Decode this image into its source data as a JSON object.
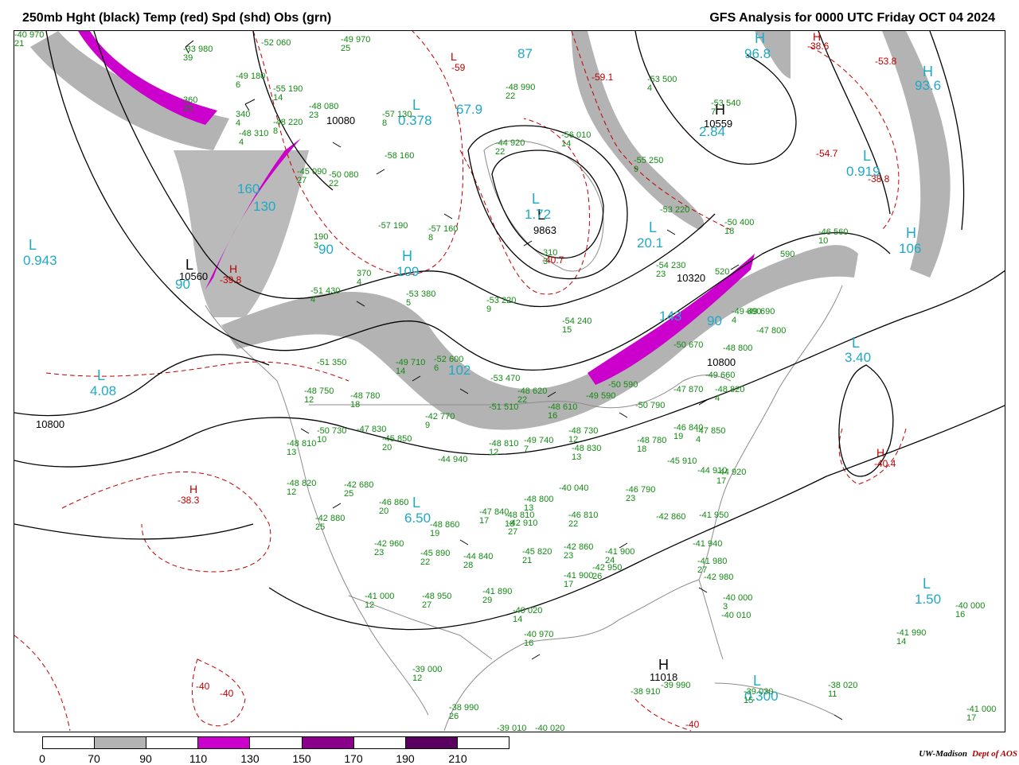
{
  "header": {
    "title_left": "250mb Hght (black) Temp (red) Spd (shd) Obs (grn)",
    "title_right": "GFS Analysis for 0000 UTC Friday  OCT 04 2024"
  },
  "colors": {
    "height_contour": "#000000",
    "temperature_contour": "#c00000",
    "observations": "#138a13",
    "speed_label": "#1ea9c8",
    "speed_70_90": "#b3b3b3",
    "speed_110_130": "#cc00cc",
    "speed_150_170": "#8b008b",
    "speed_190_210": "#5a0060",
    "borders": "#8c8c8c"
  },
  "height_labels": [
    {
      "text": "10080"
    },
    {
      "text": "10559"
    },
    {
      "text": "9863"
    },
    {
      "text": "10560"
    },
    {
      "text": "10320"
    },
    {
      "text": "10800"
    },
    {
      "text": "10800"
    },
    {
      "text": "11018"
    }
  ],
  "pressure_centers_black": [
    {
      "text": "H"
    },
    {
      "text": "L"
    },
    {
      "text": "L"
    },
    {
      "text": "H"
    }
  ],
  "temperature_labels": [
    {
      "text": "-38.6"
    },
    {
      "text": "-53.8"
    },
    {
      "text": "-59.1"
    },
    {
      "text": "-54.7"
    },
    {
      "text": "-38.8"
    },
    {
      "text": "-40.7"
    },
    {
      "text": "-39.8"
    },
    {
      "text": "-38.3"
    },
    {
      "text": "-40.4"
    },
    {
      "text": "-40"
    },
    {
      "text": "-40"
    },
    {
      "text": "-40"
    },
    {
      "text": "-59"
    }
  ],
  "temperature_centers": [
    {
      "text": "H"
    },
    {
      "text": "H"
    },
    {
      "text": "H"
    },
    {
      "text": "H"
    },
    {
      "text": "L"
    }
  ],
  "speed_labels": [
    {
      "text": "96.8"
    },
    {
      "text": "93.6"
    },
    {
      "text": "2.84"
    },
    {
      "text": "0.919"
    },
    {
      "text": "0.378"
    },
    {
      "text": "67.9"
    },
    {
      "text": "1.72"
    },
    {
      "text": "20.1"
    },
    {
      "text": "106"
    },
    {
      "text": "0.943"
    },
    {
      "text": "109"
    },
    {
      "text": "90"
    },
    {
      "text": "4.08"
    },
    {
      "text": "3.40"
    },
    {
      "text": "6.50"
    },
    {
      "text": "1.50"
    },
    {
      "text": "0.300"
    },
    {
      "text": "160"
    },
    {
      "text": "130"
    },
    {
      "text": "143"
    },
    {
      "text": "90"
    },
    {
      "text": "102"
    },
    {
      "text": "87"
    },
    {
      "text": "90"
    }
  ],
  "speed_centers": [
    {
      "text": "H"
    },
    {
      "text": "H"
    },
    {
      "text": "L"
    },
    {
      "text": "L"
    },
    {
      "text": "L"
    },
    {
      "text": "L"
    },
    {
      "text": "H"
    },
    {
      "text": "L"
    },
    {
      "text": "H"
    },
    {
      "text": "L"
    },
    {
      "text": "L"
    },
    {
      "text": "L"
    },
    {
      "text": "L"
    },
    {
      "text": "L"
    }
  ],
  "observations": [
    {
      "temp": "-33",
      "hgt": "980",
      "dew": "39"
    },
    {
      "temp": "-52",
      "hgt": "060",
      "dew": ""
    },
    {
      "temp": "-49",
      "hgt": "970",
      "dew": "25"
    },
    {
      "temp": "-49",
      "hgt": "180",
      "dew": "6"
    },
    {
      "temp": "-55",
      "hgt": "190",
      "dew": "14"
    },
    {
      "temp": "-48",
      "hgt": "080",
      "dew": "23"
    },
    {
      "temp": "-48",
      "hgt": "220",
      "dew": "8"
    },
    {
      "temp": "",
      "hgt": "360",
      "dew": "25"
    },
    {
      "temp": "",
      "hgt": "340",
      "dew": "4"
    },
    {
      "temp": "-48",
      "hgt": "310",
      "dew": "4"
    },
    {
      "temp": "-57",
      "hgt": "130",
      "dew": "8"
    },
    {
      "temp": "-58",
      "hgt": "160",
      "dew": ""
    },
    {
      "temp": "-45",
      "hgt": "090",
      "dew": "27"
    },
    {
      "temp": "-50",
      "hgt": "080",
      "dew": "22"
    },
    {
      "temp": "-48",
      "hgt": "990",
      "dew": "22"
    },
    {
      "temp": "-44",
      "hgt": "920",
      "dew": "22"
    },
    {
      "temp": "-56",
      "hgt": "010",
      "dew": "14"
    },
    {
      "temp": "-53",
      "hgt": "500",
      "dew": "4"
    },
    {
      "temp": "-53",
      "hgt": "540",
      "dew": "7"
    },
    {
      "temp": "-55",
      "hgt": "250",
      "dew": "9"
    },
    {
      "temp": "-53",
      "hgt": "220",
      "dew": ""
    },
    {
      "temp": "-50",
      "hgt": "400",
      "dew": "18"
    },
    {
      "temp": "-57",
      "hgt": "190",
      "dew": ""
    },
    {
      "temp": "-57",
      "hgt": "160",
      "dew": "8"
    },
    {
      "temp": "",
      "hgt": "190",
      "dew": "3"
    },
    {
      "temp": "-54",
      "hgt": "230",
      "dew": "23"
    },
    {
      "temp": "",
      "hgt": "310",
      "dew": "3"
    },
    {
      "temp": "",
      "hgt": "590",
      "dew": ""
    },
    {
      "temp": "-46",
      "hgt": "560",
      "dew": "10"
    },
    {
      "temp": "",
      "hgt": "520",
      "dew": ""
    },
    {
      "temp": "-51",
      "hgt": "430",
      "dew": "4"
    },
    {
      "temp": "",
      "hgt": "370",
      "dew": "4"
    },
    {
      "temp": "-53",
      "hgt": "380",
      "dew": "5"
    },
    {
      "temp": "-53",
      "hgt": "220",
      "dew": "9"
    },
    {
      "temp": "-54",
      "hgt": "240",
      "dew": "15"
    },
    {
      "temp": "-49",
      "hgt": "690",
      "dew": "4"
    },
    {
      "temp": "-49",
      "hgt": "690",
      "dew": ""
    },
    {
      "temp": "-47",
      "hgt": "800",
      "dew": ""
    },
    {
      "temp": "-50",
      "hgt": "670",
      "dew": ""
    },
    {
      "temp": "-48",
      "hgt": "800",
      "dew": ""
    },
    {
      "temp": "-51",
      "hgt": "350",
      "dew": ""
    },
    {
      "temp": "-49",
      "hgt": "710",
      "dew": "14"
    },
    {
      "temp": "-52",
      "hgt": "600",
      "dew": "6"
    },
    {
      "temp": "-53",
      "hgt": "470",
      "dew": ""
    },
    {
      "temp": "-48",
      "hgt": "620",
      "dew": "22"
    },
    {
      "temp": "-51",
      "hgt": "510",
      "dew": ""
    },
    {
      "temp": "-48",
      "hgt": "610",
      "dew": "16"
    },
    {
      "temp": "-49",
      "hgt": "590",
      "dew": ""
    },
    {
      "temp": "-50",
      "hgt": "590",
      "dew": ""
    },
    {
      "temp": "-49",
      "hgt": "660",
      "dew": ""
    },
    {
      "temp": "-48",
      "hgt": "820",
      "dew": "4"
    },
    {
      "temp": "-47",
      "hgt": "870",
      "dew": ""
    },
    {
      "temp": "-50",
      "hgt": "790",
      "dew": ""
    },
    {
      "temp": "-48",
      "hgt": "750",
      "dew": "12"
    },
    {
      "temp": "-48",
      "hgt": "780",
      "dew": "18"
    },
    {
      "temp": "-42",
      "hgt": "770",
      "dew": "9"
    },
    {
      "temp": "-50",
      "hgt": "730",
      "dew": "10"
    },
    {
      "temp": "-47",
      "hgt": "830",
      "dew": ""
    },
    {
      "temp": "-48",
      "hgt": "810",
      "dew": "13"
    },
    {
      "temp": "-45",
      "hgt": "850",
      "dew": "20"
    },
    {
      "temp": "-48",
      "hgt": "810",
      "dew": "12"
    },
    {
      "temp": "-49",
      "hgt": "740",
      "dew": "7"
    },
    {
      "temp": "-48",
      "hgt": "730",
      "dew": "12"
    },
    {
      "temp": "-48",
      "hgt": "830",
      "dew": "13"
    },
    {
      "temp": "-48",
      "hgt": "780",
      "dew": "18"
    },
    {
      "temp": "-46",
      "hgt": "840",
      "dew": "19"
    },
    {
      "temp": "-47",
      "hgt": "850",
      "dew": "4"
    },
    {
      "temp": "-45",
      "hgt": "910",
      "dew": ""
    },
    {
      "temp": "-44",
      "hgt": "910",
      "dew": ""
    },
    {
      "temp": "-44",
      "hgt": "920",
      "dew": "17"
    },
    {
      "temp": "-44",
      "hgt": "940",
      "dew": ""
    },
    {
      "temp": "-48",
      "hgt": "820",
      "dew": "12"
    },
    {
      "temp": "-42",
      "hgt": "680",
      "dew": "25"
    },
    {
      "temp": "-46",
      "hgt": "860",
      "dew": "20"
    },
    {
      "temp": "-48",
      "hgt": "860",
      "dew": "19"
    },
    {
      "temp": "-47",
      "hgt": "840",
      "dew": "17"
    },
    {
      "temp": "-48",
      "hgt": "800",
      "dew": "13"
    },
    {
      "temp": "-40",
      "hgt": "040",
      "dew": ""
    },
    {
      "temp": "-46",
      "hgt": "790",
      "dew": "23"
    },
    {
      "temp": "-42",
      "hgt": "880",
      "dew": "25"
    },
    {
      "temp": "-42",
      "hgt": "910",
      "dew": "27"
    },
    {
      "temp": "-48",
      "hgt": "810",
      "dew": "18"
    },
    {
      "temp": "-46",
      "hgt": "810",
      "dew": "22"
    },
    {
      "temp": "-42",
      "hgt": "860",
      "dew": ""
    },
    {
      "temp": "-41",
      "hgt": "950",
      "dew": ""
    },
    {
      "temp": "-42",
      "hgt": "960",
      "dew": "23"
    },
    {
      "temp": "-45",
      "hgt": "890",
      "dew": "22"
    },
    {
      "temp": "-44",
      "hgt": "840",
      "dew": "28"
    },
    {
      "temp": "-45",
      "hgt": "820",
      "dew": "21"
    },
    {
      "temp": "-42",
      "hgt": "860",
      "dew": "23"
    },
    {
      "temp": "-41",
      "hgt": "900",
      "dew": "24"
    },
    {
      "temp": "-41",
      "hgt": "940",
      "dew": ""
    },
    {
      "temp": "-41",
      "hgt": "980",
      "dew": "27"
    },
    {
      "temp": "-41",
      "hgt": "000",
      "dew": "12"
    },
    {
      "temp": "-48",
      "hgt": "950",
      "dew": "27"
    },
    {
      "temp": "-41",
      "hgt": "890",
      "dew": "29"
    },
    {
      "temp": "-41",
      "hgt": "900",
      "dew": "17"
    },
    {
      "temp": "-42",
      "hgt": "950",
      "dew": "26"
    },
    {
      "temp": "-42",
      "hgt": "980",
      "dew": ""
    },
    {
      "temp": "-40",
      "hgt": "000",
      "dew": "3"
    },
    {
      "temp": "-40",
      "hgt": "010",
      "dew": ""
    },
    {
      "temp": "-40",
      "hgt": "020",
      "dew": "14"
    },
    {
      "temp": "-40",
      "hgt": "970",
      "dew": "16"
    },
    {
      "temp": "-39",
      "hgt": "000",
      "dew": "12"
    },
    {
      "temp": "-38",
      "hgt": "990",
      "dew": "26"
    },
    {
      "temp": "-39",
      "hgt": "010",
      "dew": "11"
    },
    {
      "temp": "-40",
      "hgt": "020",
      "dew": ""
    },
    {
      "temp": "-38",
      "hgt": "910",
      "dew": ""
    },
    {
      "temp": "-39",
      "hgt": "990",
      "dew": ""
    },
    {
      "temp": "-39",
      "hgt": "030",
      "dew": "15"
    },
    {
      "temp": "-38",
      "hgt": "020",
      "dew": "11"
    },
    {
      "temp": "-40",
      "hgt": "000",
      "dew": "16"
    },
    {
      "temp": "-41",
      "hgt": "990",
      "dew": "14"
    },
    {
      "temp": "-41",
      "hgt": "000",
      "dew": "17"
    },
    {
      "temp": "-40",
      "hgt": "970",
      "dew": "21"
    }
  ],
  "legend": {
    "ticks": [
      "0",
      "70",
      "90",
      "110",
      "130",
      "150",
      "170",
      "190",
      "210"
    ],
    "fill_colors": [
      "#ffffff",
      "#b3b3b3",
      "#ffffff",
      "#cc00cc",
      "#ffffff",
      "#8b008b",
      "#ffffff",
      "#5a0060",
      "#ffffff"
    ]
  },
  "credit": {
    "org": "UW-Madison",
    "dept": "Dept of AOS"
  }
}
